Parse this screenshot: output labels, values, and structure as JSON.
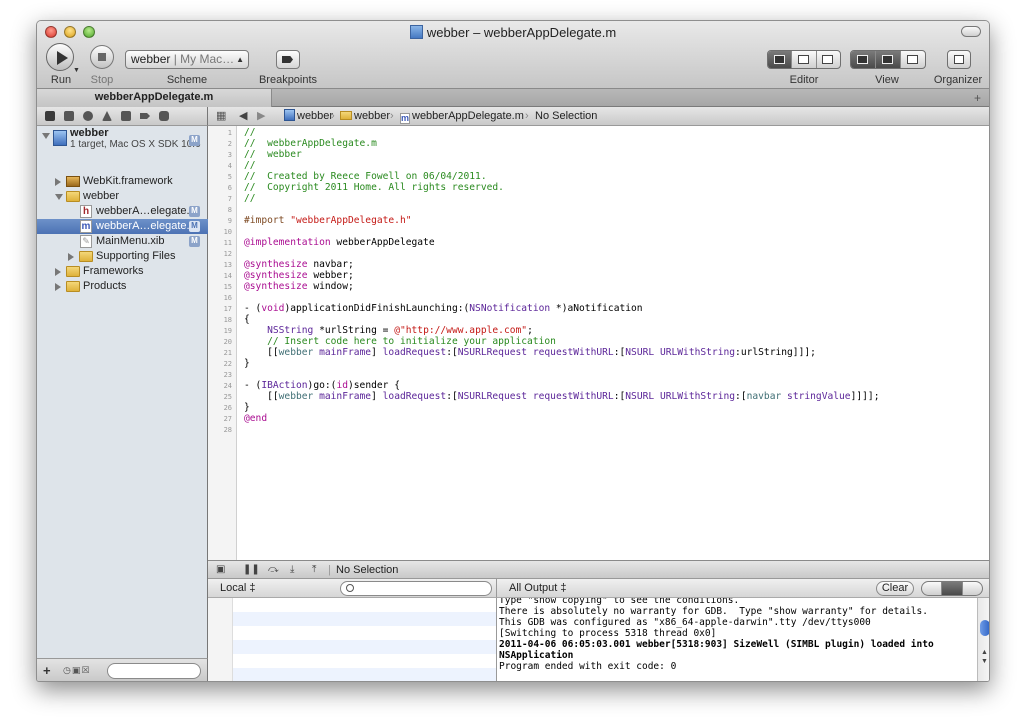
{
  "window": {
    "title": "webber – webberAppDelegate.m"
  },
  "toolbar": {
    "run_label": "Run",
    "stop_label": "Stop",
    "scheme_label": "Scheme",
    "scheme_target": "webber",
    "scheme_destination": "My Mac…",
    "breakpoints_label": "Breakpoints",
    "editor_label": "Editor",
    "view_label": "View",
    "organizer_label": "Organizer"
  },
  "tab": {
    "active_label": "webberAppDelegate.m",
    "add_symbol": "+"
  },
  "navigator": {
    "project_name": "webber",
    "project_subtitle": "1 target, Mac OS X SDK 10.6",
    "modified_badge": "M",
    "items": [
      {
        "label": "WebKit.framework"
      },
      {
        "label": "webber"
      },
      {
        "label": "webberA…elegate.h",
        "badge": "M"
      },
      {
        "label": "webberA…elegate.m",
        "badge": "M"
      },
      {
        "label": "MainMenu.xib",
        "badge": "M"
      },
      {
        "label": "Supporting Files"
      },
      {
        "label": "Frameworks"
      },
      {
        "label": "Products"
      }
    ],
    "add_symbol": "+"
  },
  "jumpbar": {
    "crumbs": [
      "webber",
      "webber",
      "webberAppDelegate.m",
      "No Selection"
    ]
  },
  "editor": {
    "line_numbers": [
      "1",
      "2",
      "3",
      "4",
      "5",
      "6",
      "7",
      "8",
      "9",
      "10",
      "11",
      "12",
      "13",
      "14",
      "15",
      "16",
      "17",
      "18",
      "19",
      "20",
      "21",
      "22",
      "23",
      "24",
      "25",
      "26",
      "27",
      "28"
    ]
  },
  "debug": {
    "selection_label": "No Selection"
  },
  "variables": {
    "scope": "Local ‡"
  },
  "console": {
    "filter": "All Output ‡",
    "clear_label": "Clear",
    "lines": [
      "Type \"show copying\" to see the conditions.",
      "There is absolutely no warranty for GDB.  Type \"show warranty\" for details.",
      "This GDB was configured as \"x86_64-apple-darwin\".tty /dev/ttys000",
      "[Switching to process 5318 thread 0x0]",
      "2011-04-06 06:05:03.001 webber[5318:903] SizeWell (SIMBL plugin) loaded into",
      "NSApplication",
      "Program ended with exit code: 0"
    ]
  },
  "colors": {
    "selection": "#4c72b4",
    "comment": "#2a8a1f",
    "string": "#c41a16",
    "keyword": "#aa0d91"
  }
}
